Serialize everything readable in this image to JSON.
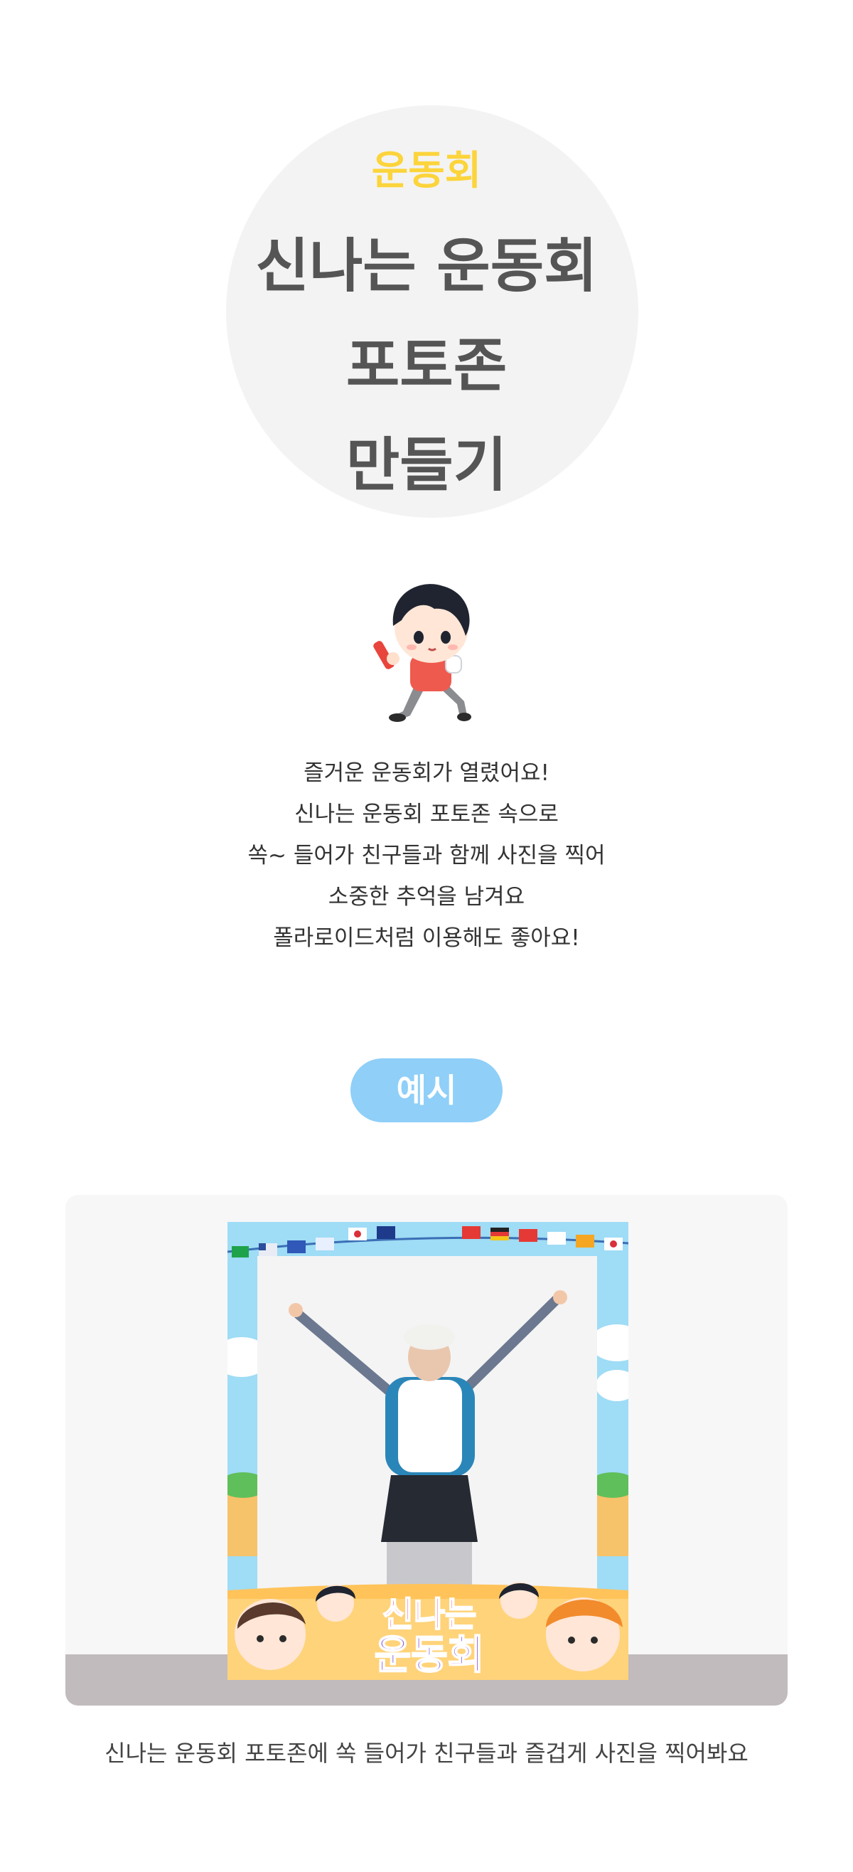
{
  "hero": {
    "category": "운동회",
    "title_lines": [
      "신나는 운동회",
      "포토존",
      "만들기"
    ]
  },
  "description": [
    "즐거운 운동회가 열렸어요!",
    "신나는 운동회 포토존 속으로",
    "쏙~ 들어가 친구들과 함께 사진을 찍어",
    "소중한 추억을 남겨요",
    "폴라로이드처럼 이용해도 좋아요!"
  ],
  "example": {
    "badge_label": "예시",
    "frame_text_line1": "신나는",
    "frame_text_line2": "운동회"
  },
  "caption": "신나는 운동회 포토존에 쏙 들어가 친구들과 즐겁게 사진을 찍어봐요",
  "colors": {
    "category": "#fcd43b",
    "title": "#555555",
    "badge": "#8fcff8",
    "hero_circle": "#f3f3f3"
  }
}
